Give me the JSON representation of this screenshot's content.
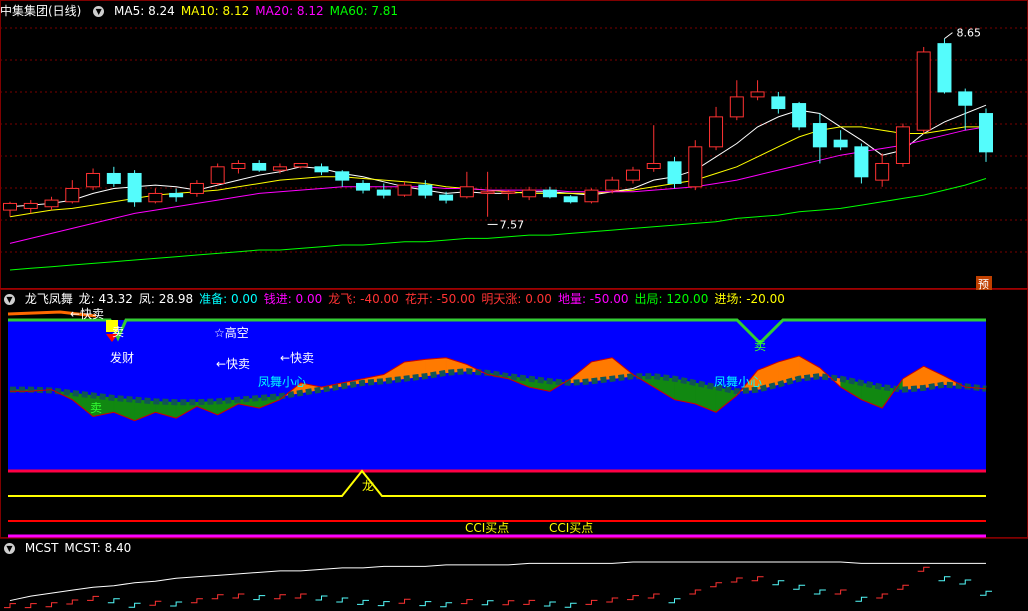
{
  "main_panel": {
    "title": "中集集团(日线)",
    "indicators": [
      {
        "label": "MA5: 8.24",
        "color": "#ffffff"
      },
      {
        "label": "MA10: 8.12",
        "color": "#ffff00"
      },
      {
        "label": "MA20: 8.12",
        "color": "#ff00ff"
      },
      {
        "label": "MA60: 7.81",
        "color": "#00ff00"
      }
    ],
    "high_label": "8.65",
    "low_label": "7.57",
    "badge": "预"
  },
  "mid_panel": {
    "title": "龙飞凤舞",
    "indicators": [
      {
        "label": "龙: 43.32",
        "color": "#ffffff"
      },
      {
        "label": "凤: 28.98",
        "color": "#ffffff"
      },
      {
        "label": "准备: 0.00",
        "color": "#00ffff"
      },
      {
        "label": "钱进: 0.00",
        "color": "#ff00ff"
      },
      {
        "label": "龙飞: -40.00",
        "color": "#ff3333"
      },
      {
        "label": "花开: -50.00",
        "color": "#ff3333"
      },
      {
        "label": "明天涨: 0.00",
        "color": "#ff3333"
      },
      {
        "label": "地量: -50.00",
        "color": "#ff00ff"
      },
      {
        "label": "出局: 120.00",
        "color": "#00ff00"
      },
      {
        "label": "进场: -20.00",
        "color": "#ffff00"
      }
    ],
    "annotations": {
      "kuaimai_top": "←快卖",
      "mai1": "卖",
      "facai": "发财",
      "gaokong": "☆高空",
      "kuaimai2": "←快卖",
      "kuaimai3": "←快卖",
      "fengwu1": "凤舞小心",
      "mai2": "卖",
      "fengwu2": "凤舞小心",
      "mai3": "卖",
      "long": "龙",
      "cci1": "CCI买点",
      "cci2": "CCI买点"
    }
  },
  "bottom_panel": {
    "title": "MCST",
    "indicators": [
      {
        "label": "MCST: 8.40",
        "color": "#ffffff"
      }
    ]
  },
  "colors": {
    "up": "#ff3232",
    "down": "#54fcfc",
    "ma5": "#ffffff",
    "ma10": "#ffff00",
    "ma20": "#ff00ff",
    "ma60": "#00ff00",
    "panel_bg": "#0000ff"
  },
  "chart_data": [
    {
      "type": "candlestick",
      "ylim": [
        7.2,
        8.75
      ],
      "candles": [
        [
          7.62,
          7.66,
          7.67,
          7.58
        ],
        [
          7.63,
          7.66,
          7.68,
          7.6
        ],
        [
          7.64,
          7.68,
          7.7,
          7.62
        ],
        [
          7.67,
          7.75,
          7.8,
          7.66
        ],
        [
          7.76,
          7.84,
          7.87,
          7.74
        ],
        [
          7.84,
          7.78,
          7.88,
          7.76
        ],
        [
          7.84,
          7.67,
          7.86,
          7.64
        ],
        [
          7.67,
          7.72,
          7.75,
          7.66
        ],
        [
          7.72,
          7.7,
          7.75,
          7.67
        ],
        [
          7.72,
          7.78,
          7.8,
          7.7
        ],
        [
          7.78,
          7.88,
          7.9,
          7.77
        ],
        [
          7.87,
          7.9,
          7.92,
          7.84
        ],
        [
          7.9,
          7.86,
          7.92,
          7.85
        ],
        [
          7.86,
          7.88,
          7.9,
          7.84
        ],
        [
          7.88,
          7.9,
          7.9,
          7.87
        ],
        [
          7.88,
          7.85,
          7.9,
          7.83
        ],
        [
          7.85,
          7.8,
          7.86,
          7.76
        ],
        [
          7.78,
          7.74,
          7.8,
          7.72
        ],
        [
          7.74,
          7.71,
          7.78,
          7.69
        ],
        [
          7.71,
          7.77,
          7.79,
          7.7
        ],
        [
          7.77,
          7.71,
          7.8,
          7.69
        ],
        [
          7.71,
          7.68,
          7.73,
          7.66
        ],
        [
          7.7,
          7.76,
          7.85,
          7.69
        ],
        [
          7.73,
          7.73,
          7.85,
          7.58
        ],
        [
          7.73,
          7.73,
          7.74,
          7.68
        ],
        [
          7.7,
          7.74,
          7.76,
          7.68
        ],
        [
          7.74,
          7.7,
          7.76,
          7.69
        ],
        [
          7.7,
          7.67,
          7.71,
          7.66
        ],
        [
          7.67,
          7.74,
          7.75,
          7.66
        ],
        [
          7.74,
          7.8,
          7.82,
          7.72
        ],
        [
          7.8,
          7.86,
          7.88,
          7.78
        ],
        [
          7.87,
          7.9,
          8.13,
          7.85
        ],
        [
          7.91,
          7.78,
          7.94,
          7.75
        ],
        [
          7.76,
          8.0,
          8.04,
          7.74
        ],
        [
          8.0,
          8.18,
          8.24,
          7.98
        ],
        [
          8.18,
          8.3,
          8.4,
          8.16
        ],
        [
          8.3,
          8.33,
          8.4,
          8.28
        ],
        [
          8.3,
          8.23,
          8.33,
          8.2
        ],
        [
          8.26,
          8.12,
          8.27,
          8.1
        ],
        [
          8.14,
          8.0,
          8.2,
          7.9
        ],
        [
          8.04,
          8.0,
          8.1,
          7.98
        ],
        [
          8.0,
          7.82,
          8.02,
          7.78
        ],
        [
          7.8,
          7.9,
          7.96,
          7.76
        ],
        [
          7.9,
          8.12,
          8.14,
          7.88
        ],
        [
          8.1,
          8.57,
          8.6,
          8.08
        ],
        [
          8.62,
          8.33,
          8.65,
          8.32
        ],
        [
          8.33,
          8.25,
          8.35,
          8.1
        ],
        [
          8.2,
          7.97,
          8.23,
          7.91
        ]
      ]
    },
    {
      "type": "line",
      "series": [
        {
          "name": "MA5",
          "values": [
            7.64,
            7.65,
            7.66,
            7.68,
            7.72,
            7.75,
            7.76,
            7.77,
            7.76,
            7.74,
            7.77,
            7.8,
            7.83,
            7.85,
            7.88,
            7.87,
            7.84,
            7.82,
            7.79,
            7.76,
            7.74,
            7.72,
            7.73,
            7.72,
            7.72,
            7.73,
            7.73,
            7.72,
            7.71,
            7.73,
            7.75,
            7.8,
            7.82,
            7.86,
            7.94,
            8.02,
            8.12,
            8.18,
            8.22,
            8.2,
            8.12,
            8.04,
            7.95,
            7.98,
            8.08,
            8.15,
            8.2,
            8.25
          ]
        },
        {
          "name": "MA10",
          "values": [
            7.58,
            7.6,
            7.62,
            7.63,
            7.65,
            7.67,
            7.69,
            7.71,
            7.72,
            7.73,
            7.74,
            7.76,
            7.78,
            7.8,
            7.81,
            7.82,
            7.82,
            7.81,
            7.8,
            7.79,
            7.78,
            7.76,
            7.75,
            7.74,
            7.73,
            7.72,
            7.72,
            7.72,
            7.72,
            7.73,
            7.74,
            7.76,
            7.78,
            7.8,
            7.84,
            7.88,
            7.94,
            8.0,
            8.06,
            8.1,
            8.12,
            8.12,
            8.1,
            8.08,
            8.08,
            8.1,
            8.12,
            8.12
          ]
        },
        {
          "name": "MA20",
          "values": [
            7.42,
            7.45,
            7.48,
            7.51,
            7.54,
            7.57,
            7.6,
            7.62,
            7.64,
            7.66,
            7.68,
            7.7,
            7.72,
            7.73,
            7.74,
            7.75,
            7.76,
            7.76,
            7.76,
            7.76,
            7.76,
            7.75,
            7.75,
            7.74,
            7.74,
            7.74,
            7.74,
            7.73,
            7.73,
            7.73,
            7.73,
            7.74,
            7.75,
            7.76,
            7.78,
            7.8,
            7.83,
            7.86,
            7.89,
            7.92,
            7.95,
            7.97,
            7.99,
            8.01,
            8.04,
            8.07,
            8.1,
            8.12
          ]
        },
        {
          "name": "MA60",
          "values": [
            7.26,
            7.27,
            7.28,
            7.29,
            7.3,
            7.31,
            7.32,
            7.33,
            7.34,
            7.35,
            7.36,
            7.37,
            7.38,
            7.38,
            7.39,
            7.4,
            7.41,
            7.41,
            7.42,
            7.43,
            7.43,
            7.44,
            7.45,
            7.45,
            7.46,
            7.47,
            7.47,
            7.48,
            7.49,
            7.5,
            7.51,
            7.52,
            7.53,
            7.54,
            7.55,
            7.57,
            7.58,
            7.59,
            7.61,
            7.62,
            7.63,
            7.65,
            7.67,
            7.69,
            7.71,
            7.74,
            7.77,
            7.81
          ]
        }
      ]
    },
    {
      "type": "area",
      "ylim": [
        -55,
        125
      ],
      "series": [
        {
          "name": "龙",
          "values": [
            40,
            40,
            42,
            30,
            10,
            15,
            5,
            15,
            8,
            22,
            12,
            25,
            20,
            30,
            50,
            45,
            50,
            55,
            60,
            75,
            78,
            80,
            72,
            60,
            55,
            45,
            40,
            55,
            75,
            80,
            60,
            45,
            30,
            25,
            15,
            35,
            65,
            75,
            82,
            68,
            45,
            30,
            20,
            55,
            70,
            58,
            45,
            43
          ]
        },
        {
          "name": "凤",
          "values": [
            42,
            42,
            41,
            38,
            35,
            32,
            30,
            28,
            27,
            27,
            28,
            30,
            32,
            34,
            38,
            42,
            46,
            50,
            52,
            55,
            58,
            62,
            64,
            62,
            58,
            55,
            52,
            50,
            52,
            55,
            58,
            58,
            55,
            50,
            45,
            40,
            42,
            48,
            55,
            58,
            55,
            50,
            45,
            42,
            44,
            48,
            46,
            43
          ]
        }
      ]
    },
    {
      "type": "line",
      "series": [
        {
          "name": "MCST",
          "values": [
            8.15,
            8.18,
            8.2,
            8.22,
            8.24,
            8.25,
            8.27,
            8.28,
            8.3,
            8.31,
            8.32,
            8.33,
            8.34,
            8.35,
            8.35,
            8.36,
            8.37,
            8.37,
            8.38,
            8.38,
            8.38,
            8.39,
            8.39,
            8.39,
            8.39,
            8.4,
            8.4,
            8.4,
            8.4,
            8.4,
            8.41,
            8.41,
            8.41,
            8.41,
            8.41,
            8.41,
            8.41,
            8.41,
            8.41,
            8.41,
            8.41,
            8.4,
            8.4,
            8.4,
            8.4,
            8.4,
            8.4,
            8.4
          ]
        }
      ]
    }
  ]
}
